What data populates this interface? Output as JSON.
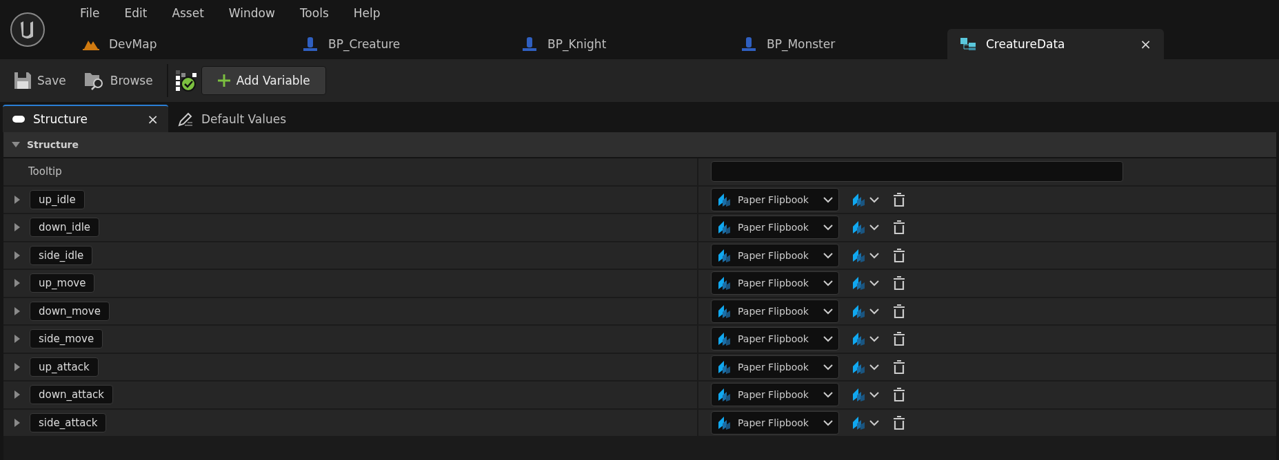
{
  "menu": [
    "File",
    "Edit",
    "Asset",
    "Window",
    "Tools",
    "Help"
  ],
  "document_tabs": [
    {
      "label": "DevMap",
      "kind": "map",
      "selected": false
    },
    {
      "label": "BP_Creature",
      "kind": "blueprint",
      "selected": false
    },
    {
      "label": "BP_Knight",
      "kind": "blueprint",
      "selected": false
    },
    {
      "label": "BP_Monster",
      "kind": "blueprint",
      "selected": false
    },
    {
      "label": "CreatureData",
      "kind": "struct",
      "selected": true,
      "close": "×"
    }
  ],
  "toolbar": {
    "save": "Save",
    "browse": "Browse",
    "add_variable": "Add Variable"
  },
  "panel_tabs": [
    {
      "label": "Structure",
      "kind": "structure",
      "selected": true,
      "close": "×"
    },
    {
      "label": "Default Values",
      "kind": "defaults",
      "selected": false
    }
  ],
  "section": {
    "title": "Structure",
    "expanded": true,
    "tooltip_label": "Tooltip"
  },
  "variables": [
    {
      "name": "up_idle",
      "type": "Paper Flipbook"
    },
    {
      "name": "down_idle",
      "type": "Paper Flipbook"
    },
    {
      "name": "side_idle",
      "type": "Paper Flipbook"
    },
    {
      "name": "up_move",
      "type": "Paper Flipbook"
    },
    {
      "name": "down_move",
      "type": "Paper Flipbook"
    },
    {
      "name": "side_move",
      "type": "Paper Flipbook"
    },
    {
      "name": "up_attack",
      "type": "Paper Flipbook"
    },
    {
      "name": "down_attack",
      "type": "Paper Flipbook"
    },
    {
      "name": "side_attack",
      "type": "Paper Flipbook"
    }
  ]
}
